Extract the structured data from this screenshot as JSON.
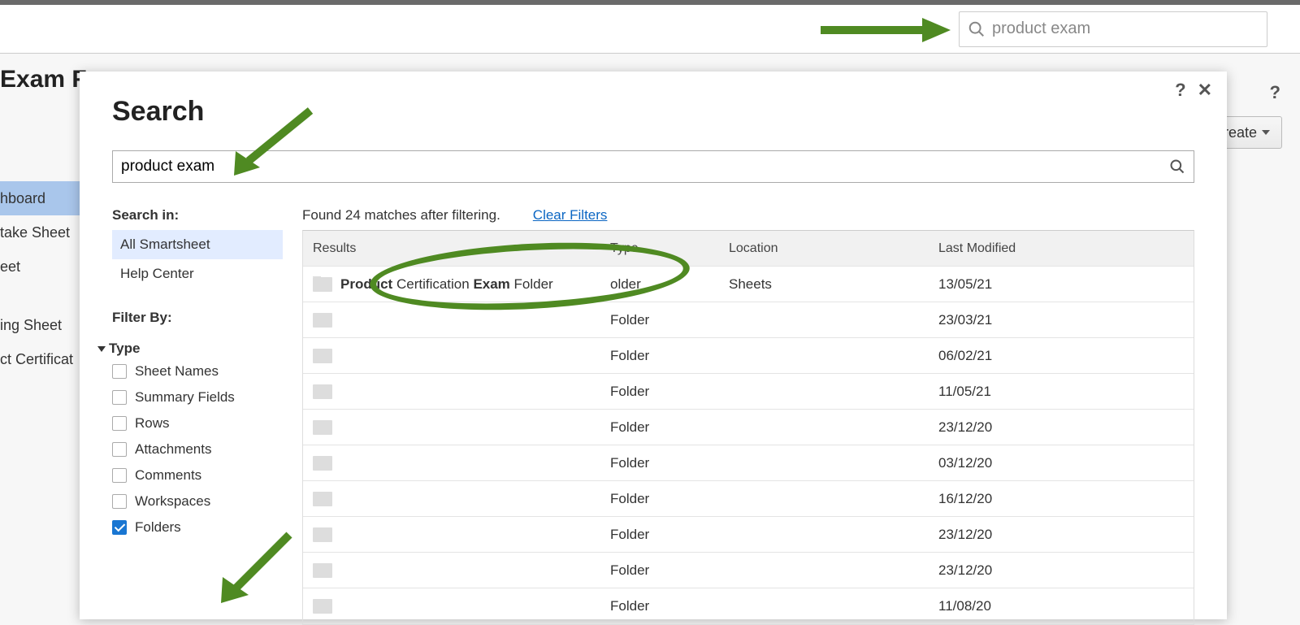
{
  "topbar": {
    "search_value": "product exam"
  },
  "background": {
    "page_title_partial": " Exam F",
    "help": "?",
    "create_label": "Create",
    "sidebar_items": [
      "hboard",
      "take Sheet",
      "eet",
      "ing Sheet",
      "ct Certificat"
    ]
  },
  "modal": {
    "title": "Search",
    "help": "?",
    "close": "✕",
    "search_value": "product exam",
    "scope_label": "Search in:",
    "scopes": [
      "All Smartsheet",
      "Help Center"
    ],
    "scope_selected": 0,
    "filter_label": "Filter By:",
    "type_label": "Type",
    "type_filters": [
      {
        "label": "Sheet Names",
        "checked": false
      },
      {
        "label": "Summary Fields",
        "checked": false
      },
      {
        "label": "Rows",
        "checked": false
      },
      {
        "label": "Attachments",
        "checked": false
      },
      {
        "label": "Comments",
        "checked": false
      },
      {
        "label": "Workspaces",
        "checked": false
      },
      {
        "label": "Folders",
        "checked": true
      }
    ],
    "results_summary": "Found 24 matches after filtering.",
    "clear_filters": "Clear Filters",
    "columns": {
      "results": "Results",
      "type": "Type",
      "location": "Location",
      "modified": "Last Modified"
    },
    "rows": [
      {
        "name_html": "<b>Product</b> Certification <b>Exam</b> Folder",
        "type": "older",
        "location": "Sheets",
        "modified": "13/05/21",
        "redacted": false
      },
      {
        "type": "Folder",
        "modified": "23/03/21",
        "redacted": true
      },
      {
        "type": "Folder",
        "modified": "06/02/21",
        "redacted": true
      },
      {
        "type": "Folder",
        "modified": "11/05/21",
        "redacted": true
      },
      {
        "type": "Folder",
        "modified": "23/12/20",
        "redacted": true
      },
      {
        "type": "Folder",
        "modified": "03/12/20",
        "redacted": true
      },
      {
        "type": "Folder",
        "modified": "16/12/20",
        "redacted": true
      },
      {
        "type": "Folder",
        "modified": "23/12/20",
        "redacted": true
      },
      {
        "type": "Folder",
        "modified": "23/12/20",
        "redacted": true
      },
      {
        "type": "Folder",
        "modified": "11/08/20",
        "redacted": true
      }
    ]
  }
}
